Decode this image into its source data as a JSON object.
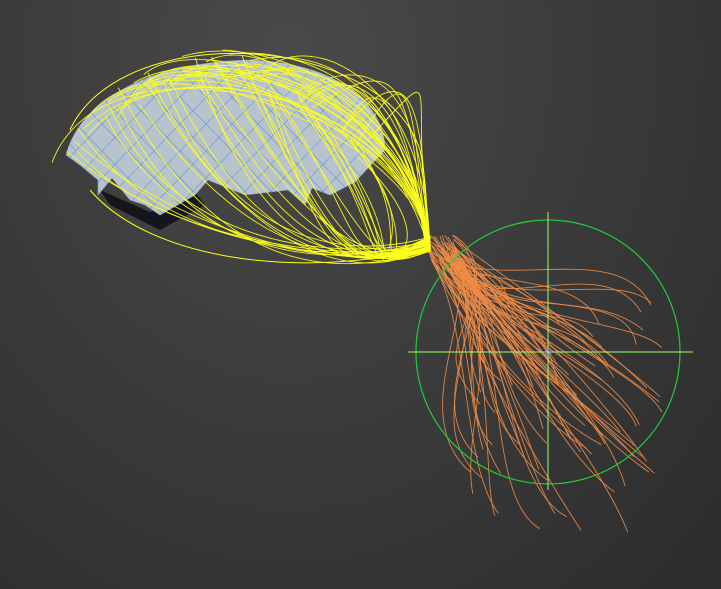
{
  "viewport": {
    "kind": "3d-perspective-viewport",
    "background": "#3a3a3a"
  },
  "scene": {
    "scalp_mesh": {
      "name": "scalp-mesh",
      "fill": "#b7c3cd",
      "wire_color": "#5b8fd6",
      "shadow": "#15161c"
    },
    "hair_guides_selected": {
      "name": "yellow-hair-guides",
      "color": "#ffff1e",
      "style": "selected guide splines"
    },
    "hair_guides_ponytail": {
      "name": "orange-hair-strands",
      "color": "#f08c46",
      "style": "interpolated strands"
    },
    "gizmo": {
      "name": "transform-gizmo",
      "circle_color": "#1ecc3a",
      "crosshair_color": "#9aff6a",
      "pivot_color": "#7f6bff",
      "type": "rotate-circle"
    }
  }
}
